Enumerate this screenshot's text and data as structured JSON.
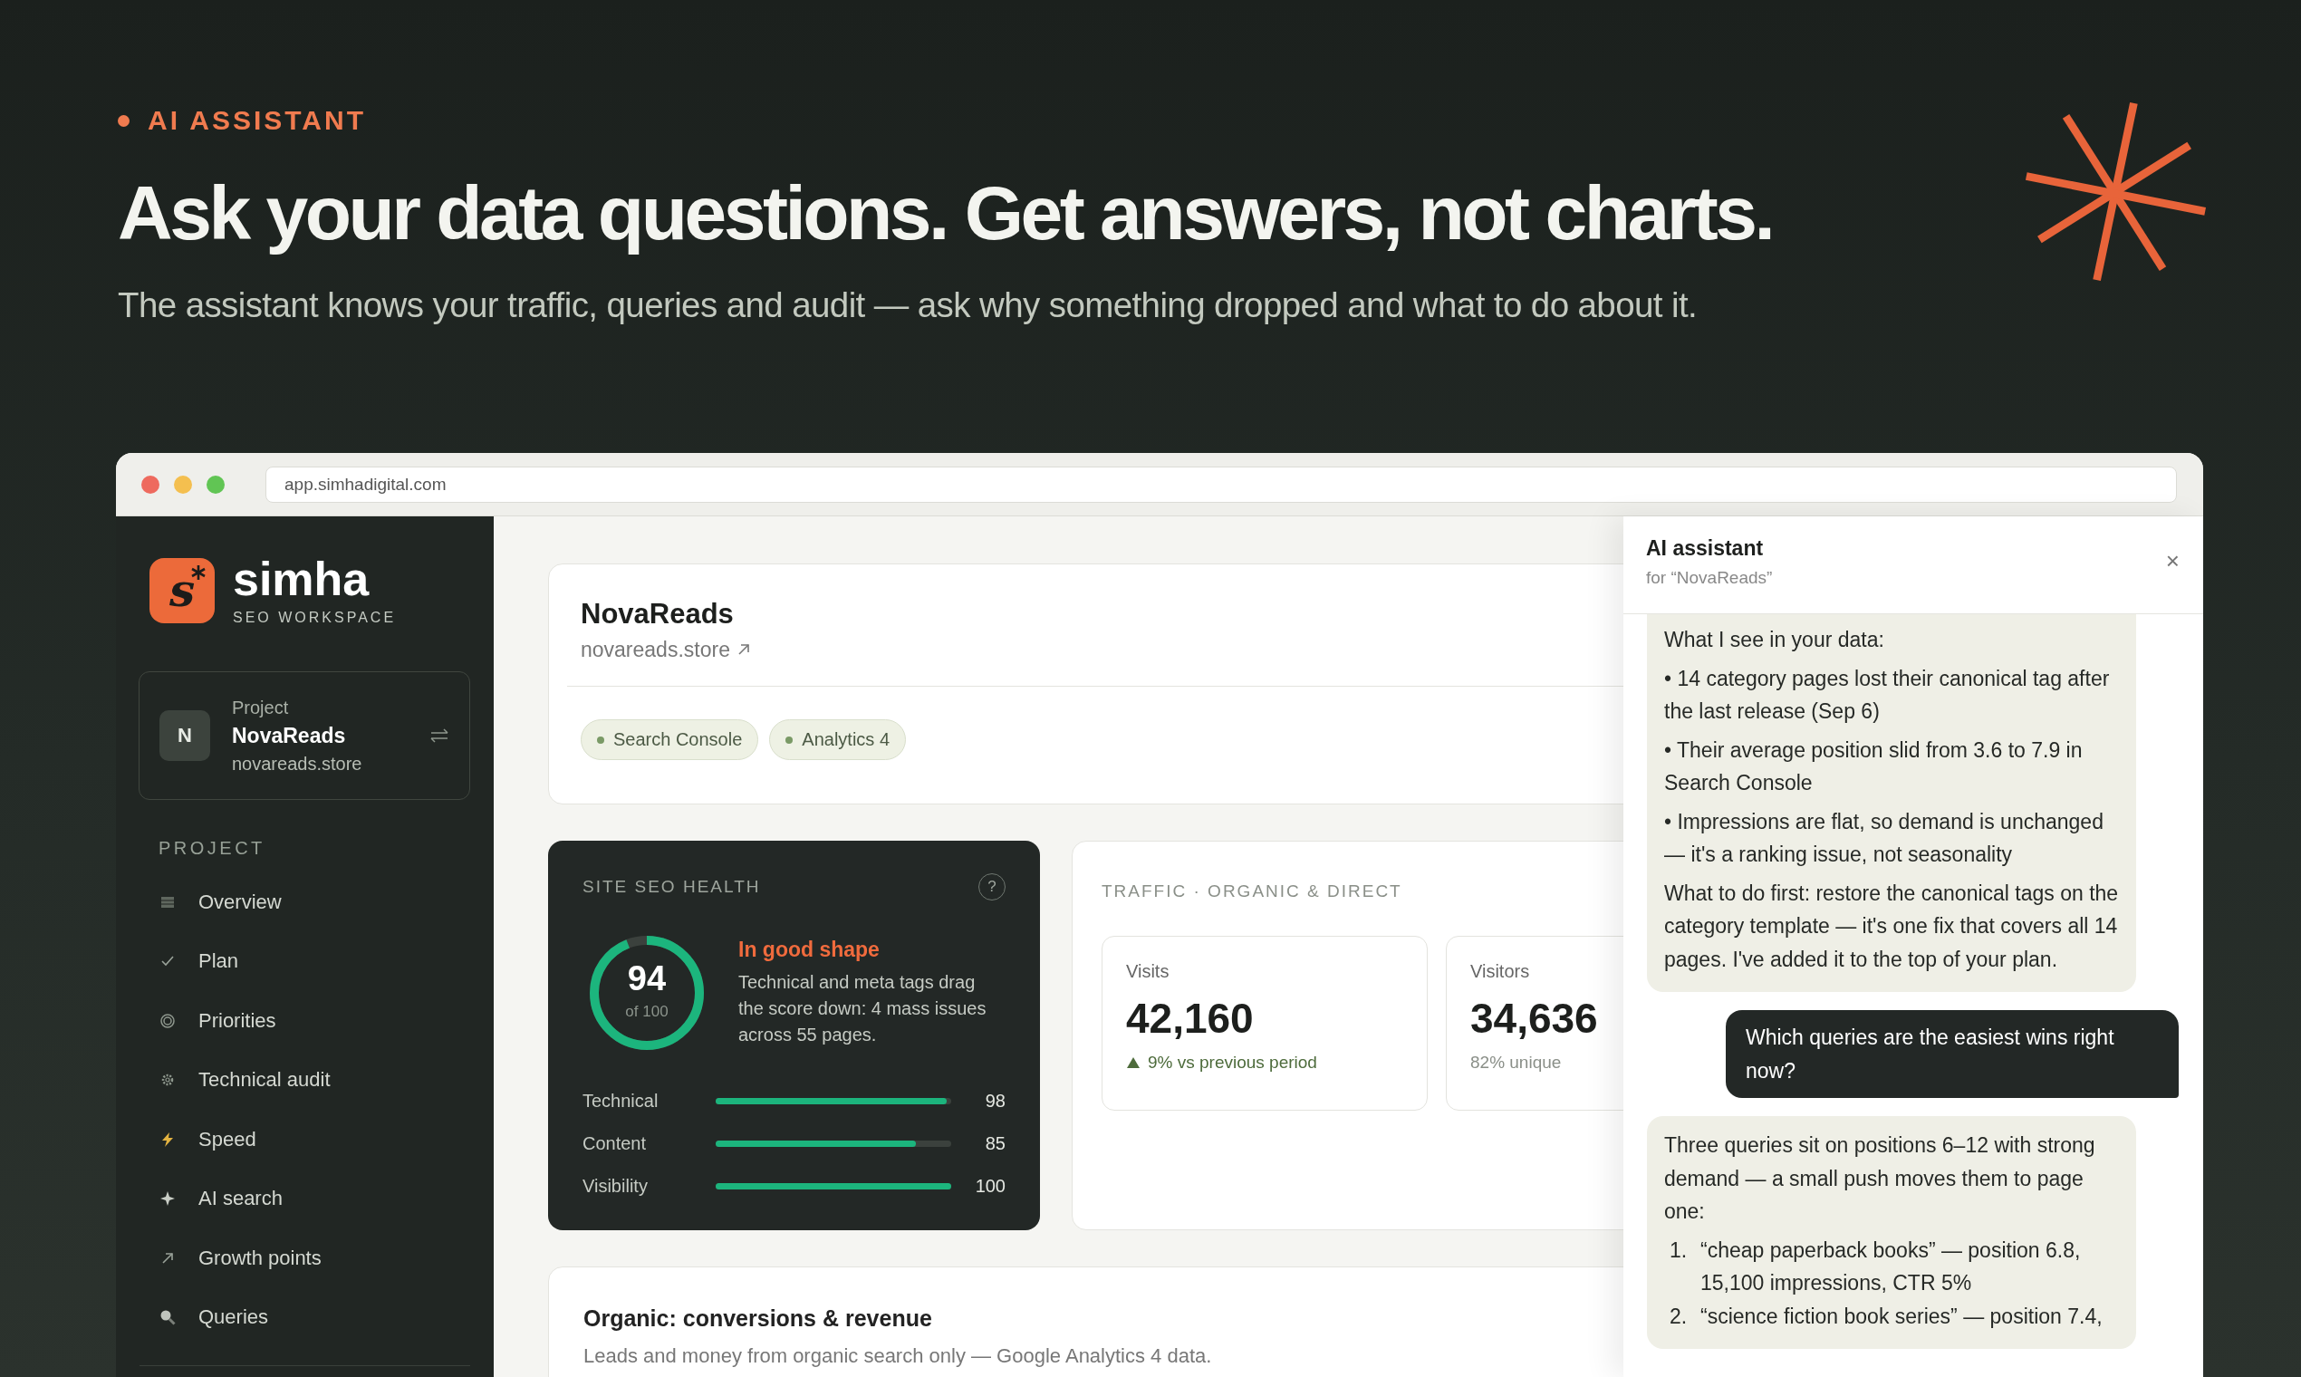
{
  "hero": {
    "eyebrow": "AI ASSISTANT",
    "headline": "Ask your data questions. Get answers, not charts.",
    "subtitle": "The assistant knows your traffic, queries and audit — ask why something dropped and what to do about it."
  },
  "browser": {
    "url": "app.simhadigital.com"
  },
  "sidebar": {
    "logo": {
      "mark": "s",
      "name": "simha",
      "tagline": "SEO WORKSPACE"
    },
    "project": {
      "avatar": "N",
      "label": "Project",
      "name": "NovaReads",
      "domain": "novareads.store"
    },
    "section": "PROJECT",
    "items": [
      {
        "label": "Overview",
        "kind": "list"
      },
      {
        "label": "Plan",
        "kind": "check"
      },
      {
        "label": "Priorities",
        "kind": "target"
      },
      {
        "label": "Technical audit",
        "kind": "gear"
      },
      {
        "label": "Speed",
        "kind": "bolt"
      },
      {
        "label": "AI search",
        "kind": "sparkle"
      },
      {
        "label": "Growth points",
        "kind": "arrow"
      },
      {
        "label": "Queries",
        "kind": "search"
      }
    ]
  },
  "project_header": {
    "name": "NovaReads",
    "domain": "novareads.store",
    "sources": [
      "Search Console",
      "Analytics 4"
    ]
  },
  "health": {
    "title": "SITE SEO HEALTH",
    "help": "?",
    "score": "94",
    "score_of": "of 100",
    "level": 0.94,
    "status": "In good shape",
    "description": "Technical and meta tags drag the score down: 4 mass issues across 55 pages.",
    "metrics": [
      {
        "label": "Technical",
        "level": 0.98,
        "value": "98"
      },
      {
        "label": "Content",
        "level": 0.85,
        "value": "85"
      },
      {
        "label": "Visibility",
        "level": 1,
        "value": "100"
      }
    ]
  },
  "traffic": {
    "title": "TRAFFIC · ORGANIC & DIRECT",
    "tiles": [
      {
        "label": "Visits",
        "value": "42,160",
        "note": "9% vs previous period",
        "kind": "rising"
      },
      {
        "label": "Visitors",
        "value": "34,636",
        "note": "82% unique",
        "kind": "plain"
      }
    ]
  },
  "organic": {
    "title": "Organic: conversions & revenue",
    "subtitle": "Leads and money from organic search only — Google Analytics 4 data."
  },
  "assistant": {
    "title": "AI assistant",
    "subtitle": "for “NovaReads”",
    "close": "×",
    "messages": [
      {
        "kind": "assistant",
        "paragraphs": [
          "What I see in your data:",
          "• 14 category pages lost their canonical tag after the last release (Sep 6)",
          "• Their average position slid from 3.6 to 7.9 in Search Console",
          "• Impressions are flat, so demand is unchanged — it's a ranking issue, not seasonality",
          "What to do first: restore the canonical tags on the category template — it's one fix that covers all 14 pages. I've added it to the top of your plan."
        ]
      },
      {
        "kind": "user",
        "paragraphs": [
          "Which queries are the easiest wins right now?"
        ]
      },
      {
        "kind": "assistant",
        "paragraphs": [
          "Three queries sit on positions 6–12 with strong demand — a small push moves them to page one:"
        ],
        "list": [
          {
            "number": "1.",
            "text": "“cheap paperback books” — position 6.8, 15,100 impressions, CTR 5%"
          },
          {
            "number": "2.",
            "text": "“science fiction book series” — position 7.4,"
          }
        ]
      }
    ]
  }
}
